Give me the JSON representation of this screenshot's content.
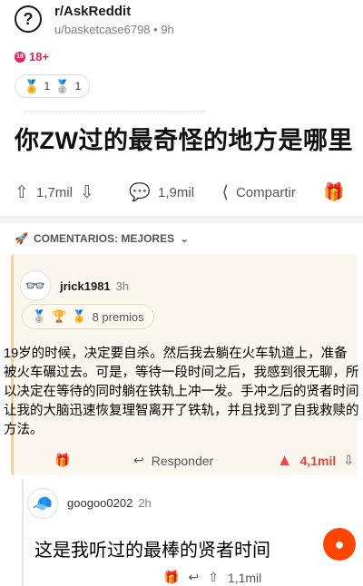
{
  "header": {
    "subreddit": "r/AskReddit",
    "user": "u/basketcase6798",
    "age": "9h",
    "nsfw_badge": "18",
    "nsfw_label": "18+",
    "awards": [
      {
        "icon": "award-icon",
        "count": "1"
      },
      {
        "icon": "silver-award-icon",
        "count": "1"
      }
    ]
  },
  "post": {
    "title": "你ZW过的最奇怪的地方是哪里",
    "upvotes": "1,7mil",
    "comments": "1,9mil",
    "share_label": "Compartir"
  },
  "sort": {
    "label": "COMENTARIOS: MEJORES"
  },
  "comment": {
    "author": "jrick1981",
    "time": "3h",
    "awards_label": "8 premios",
    "body": "19岁的时候，决定要自杀。然后我去躺在火车轨道上，准备被火车碾过去。可是，等待一段时间之后，我感到很无聊，所以决定在等待的同时躺在铁轨上冲一发。手冲之后的贤者时间让我的大脑迅速恢复理智离开了铁轨，并且找到了自我救赎的方法。",
    "reply_label": "Responder",
    "votes": "4,1mil"
  },
  "reply": {
    "author": "googoo0202",
    "time": "2h",
    "body": "这是我听过的最棒的贤者时间",
    "votes": "1,1mil"
  },
  "colors": {
    "accent": "#ff4500",
    "nsfw": "#e0245e",
    "card_bg": "#fcf7ee",
    "upvote": "#e0453b"
  }
}
